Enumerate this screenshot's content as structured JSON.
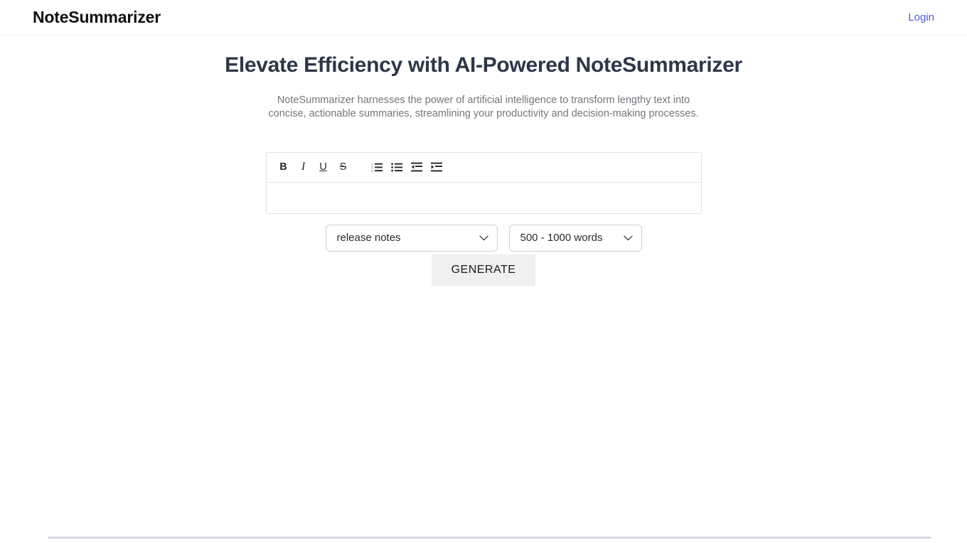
{
  "header": {
    "brand": "NoteSummarizer",
    "login_label": "Login",
    "login_color": "#4a5ad8"
  },
  "hero": {
    "title": "Elevate Efficiency with AI-Powered NoteSummarizer",
    "description": "NoteSummarizer harnesses the power of artificial intelligence to transform lengthy text into concise, actionable summaries, streamlining your productivity and decision-making processes.",
    "title_color": "#2d3748",
    "description_color": "#74767b"
  },
  "editor": {
    "toolbar": [
      {
        "name": "bold-icon",
        "glyph": "B",
        "style": "bold",
        "title": "Bold"
      },
      {
        "name": "italic-icon",
        "glyph": "I",
        "style": "italic",
        "title": "Italic"
      },
      {
        "name": "underline-icon",
        "glyph": "U",
        "style": "underline",
        "title": "Underline"
      },
      {
        "name": "strikethrough-icon",
        "glyph": "S",
        "style": "strike",
        "title": "Strikethrough"
      },
      {
        "name": "ordered-list-icon",
        "glyph": "",
        "style": "svg-ol",
        "title": "Ordered list"
      },
      {
        "name": "unordered-list-icon",
        "glyph": "",
        "style": "svg-ul",
        "title": "Bulleted list"
      },
      {
        "name": "outdent-icon",
        "glyph": "",
        "style": "svg-outdent",
        "title": "Outdent"
      },
      {
        "name": "indent-icon",
        "glyph": "",
        "style": "svg-indent",
        "title": "Indent"
      }
    ],
    "textarea_value": "",
    "textarea_placeholder": ""
  },
  "controls": {
    "document_type": {
      "selected": "release notes",
      "options": [
        "release notes"
      ]
    },
    "length": {
      "selected": "500 - 1000 words",
      "options": [
        "500 - 1000 words"
      ]
    }
  },
  "actions": {
    "generate_label": "GENERATE"
  }
}
